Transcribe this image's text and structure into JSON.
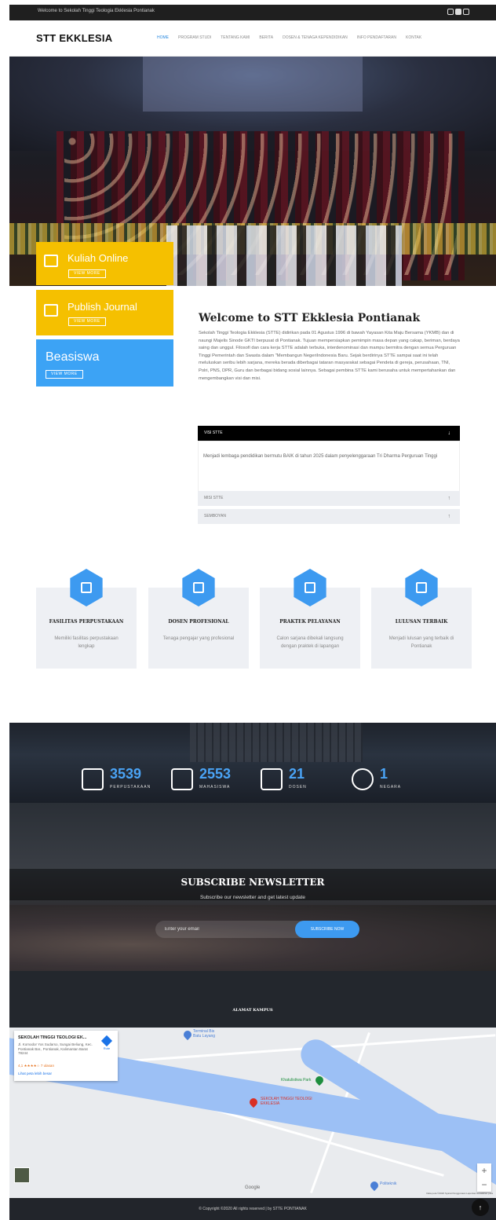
{
  "topbar": {
    "welcome": "Welcome to Sekolah Tinggi Teologia Ekklesia Pontianak"
  },
  "header": {
    "logo": "STT EKKLESIA",
    "nav": [
      "HOME",
      "PROGRAM STUDI",
      "TENTANG KAMI",
      "BERITA",
      "DOSEN & TENAGA KEPENDIDIKAN",
      "INFO PENDAFTARAN",
      "KONTAK"
    ]
  },
  "hero": {
    "banner_text": "Pascasarjana ke-22"
  },
  "features": [
    {
      "title": "Kuliah Online",
      "button": "VIEW MORE",
      "color": "#f5c000"
    },
    {
      "title": "Publish Journal",
      "button": "VIEW MORE",
      "color": "#f5c000"
    },
    {
      "title": "Beasiswa",
      "button": "VIEW MORE",
      "color": "#3ca3f5"
    }
  ],
  "welcome": {
    "title": "Welcome to STT Ekklesia Pontianak",
    "text": "Sekolah Tinggi Teologia Ekklesia (STTE) didirikan pada 01 Agustus 1996 di bawah Yayasan Kita Maju Bersama (YKMB) dan di naungi Majelis Sinode GKTI berpusat di Pontianak. Tujuan mempersiapkan pemimpin masa depan yang cakap, beriman, berdaya saing dan unggul. Filosofi dan cara kerja STTE adalah terbuka, interdenominasi dan mampu bermitra dengan semua Perguruan Tinggi Pemerintah dan Swasta dalam \"Membangun NegeriIndonesia Baru. Sejak berdirinya STTE sampai saat ini telah meluluskan seribu lebih sarjana, mereka berada diberbagai tataran masyarakat sebagai Pendeta di gereja, perusahaan, TNI, Polri, PNS, DPR, Guru dan berbagai bidang sosial lainnya. Sebagai pembina STTE kami berusaha untuk mempertahankan dan mengembangkan visi dan misi."
  },
  "accordion": [
    {
      "title": "VISI STTE",
      "body": "Menjadi lembaga pendidikan bermutu BAIK di tahun 2025 dalam penyelenggaraan Tri Dharma Perguruan Tinggi"
    },
    {
      "title": "MISI STTE"
    },
    {
      "title": "SEMBOYAN"
    }
  ],
  "cards": [
    {
      "title": "FASILITAS PERPUSTAKAAN",
      "desc": "Memiliki fasilitas perpustakaan lengkap",
      "icon": "library-icon"
    },
    {
      "title": "DOSEN PROFESIONAL",
      "desc": "Tenaga pengajar yang profesional",
      "icon": "lecturer-icon"
    },
    {
      "title": "PRAKTEK PELAYANAN",
      "desc": "Calon sarjana dibekali langsung dengan praktek di lapangan",
      "icon": "ministry-icon"
    },
    {
      "title": "LULUSAN TERBAIK",
      "desc": "Menjadi lulusan yang terbaik di Pontianak",
      "icon": "graduate-icon"
    }
  ],
  "stats": [
    {
      "number": "3539",
      "label": "PERPUSTAKAAN",
      "icon": "book-icon"
    },
    {
      "number": "2553",
      "label": "MAHASISWA",
      "icon": "student-icon"
    },
    {
      "number": "21",
      "label": "DOSEN",
      "icon": "teacher-icon"
    },
    {
      "number": "1",
      "label": "NEGARA",
      "icon": "globe-icon"
    }
  ],
  "newsletter": {
    "title": "SUBSCRIBE NEWSLETTER",
    "subtitle": "Subscribe our newsletter and get latest update",
    "placeholder": "Enter your email",
    "button": "SUBSCRIBE NOW"
  },
  "address": {
    "title": "ALAMAT KAMPUS"
  },
  "map": {
    "card_name": "SEKOLAH TINGGI TEOLOGI EK...",
    "card_address": "Jl. Komodor Yos Sudarso, Sungai Beliung, Kec. Pontianak Bar., Pontianak, Kalimantan Barat 78244",
    "rating": "4,1 ★★★★☆  7 ulasan",
    "larger_map": "Lihat peta lebih besar",
    "route": "Rute",
    "places": [
      "Terminal Bis Batu Layang",
      "Khatulistiwa Park",
      "SEKOLAH TINGGI TEOLOGI EKKLESIA",
      "Politeknik"
    ],
    "google": "Google",
    "attribution": "Data peta ©2020  Syarat Penggunaan  Laporkan kesalahan peta"
  },
  "footer": {
    "copyright": "© Copyright ©2020 All rights reserved | by STTE PONTIANAK"
  }
}
